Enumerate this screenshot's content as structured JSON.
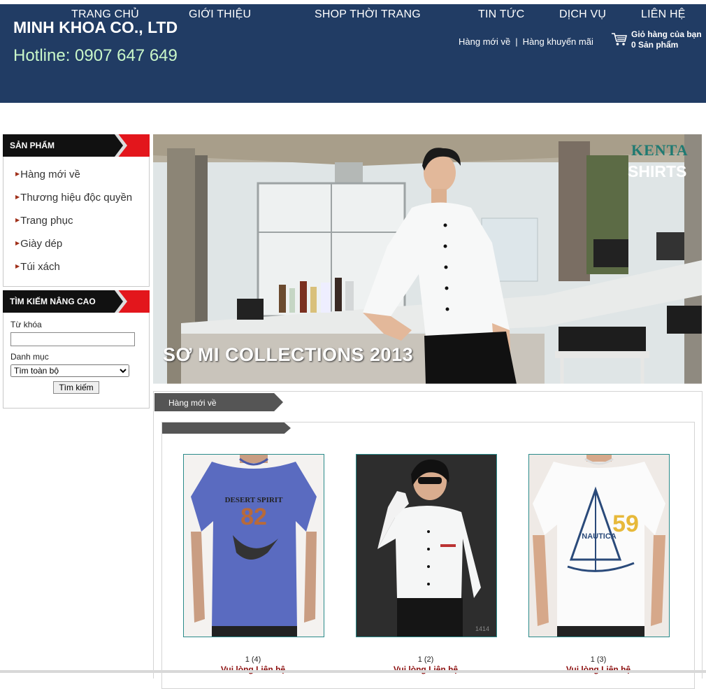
{
  "header": {
    "nav": [
      "TRANG CHỦ",
      "GIỚI THIỆU",
      "SHOP THỜI TRANG",
      "TIN TỨC",
      "DỊCH VỤ",
      "LIÊN HỆ"
    ],
    "company": "MINH KHOA CO., LTD",
    "hotline": "Hotline: 0907 647 649",
    "sublinks": [
      "Hàng mới về",
      "Hàng khuyến mãi"
    ],
    "cart_line1": "Giỏ hàng của bạn",
    "cart_line2": "0 Sản phẩm",
    "cart_icon": "shopping-cart-icon",
    "bg_color": "#213c64",
    "hotline_color": "#c9f7c9"
  },
  "sidebar": {
    "products_title": "SẢN PHẨM",
    "items": [
      "Hàng mới về",
      "Thương hiệu độc quyền",
      "Trang phục",
      "Giày dép",
      "Túi xách"
    ],
    "search_title": "TÌM KIẾM NÂNG CAO",
    "keyword_label": "Từ khóa",
    "keyword_value": "",
    "category_label": "Danh mục",
    "category_selected": "Tìm toàn bộ",
    "search_button": "Tìm kiếm",
    "accent_color": "#e3161c"
  },
  "banner": {
    "caption": "SƠ MI COLLECTIONS 2013",
    "brand_top": "KENTA",
    "brand_bottom": "SHIRTS"
  },
  "products_section": {
    "tag": "Hàng mới về",
    "items": [
      {
        "count": "1 (4)",
        "price": "Vui lòng Liên hệ",
        "image": "blue t-shirt"
      },
      {
        "count": "1 (2)",
        "price": "Vui lòng Liên hệ",
        "image": "white shirt"
      },
      {
        "count": "1 (3)",
        "price": "Vui lòng Liên hệ",
        "image": "white printed t-shirt"
      }
    ],
    "price_color": "#8c0f0f"
  }
}
